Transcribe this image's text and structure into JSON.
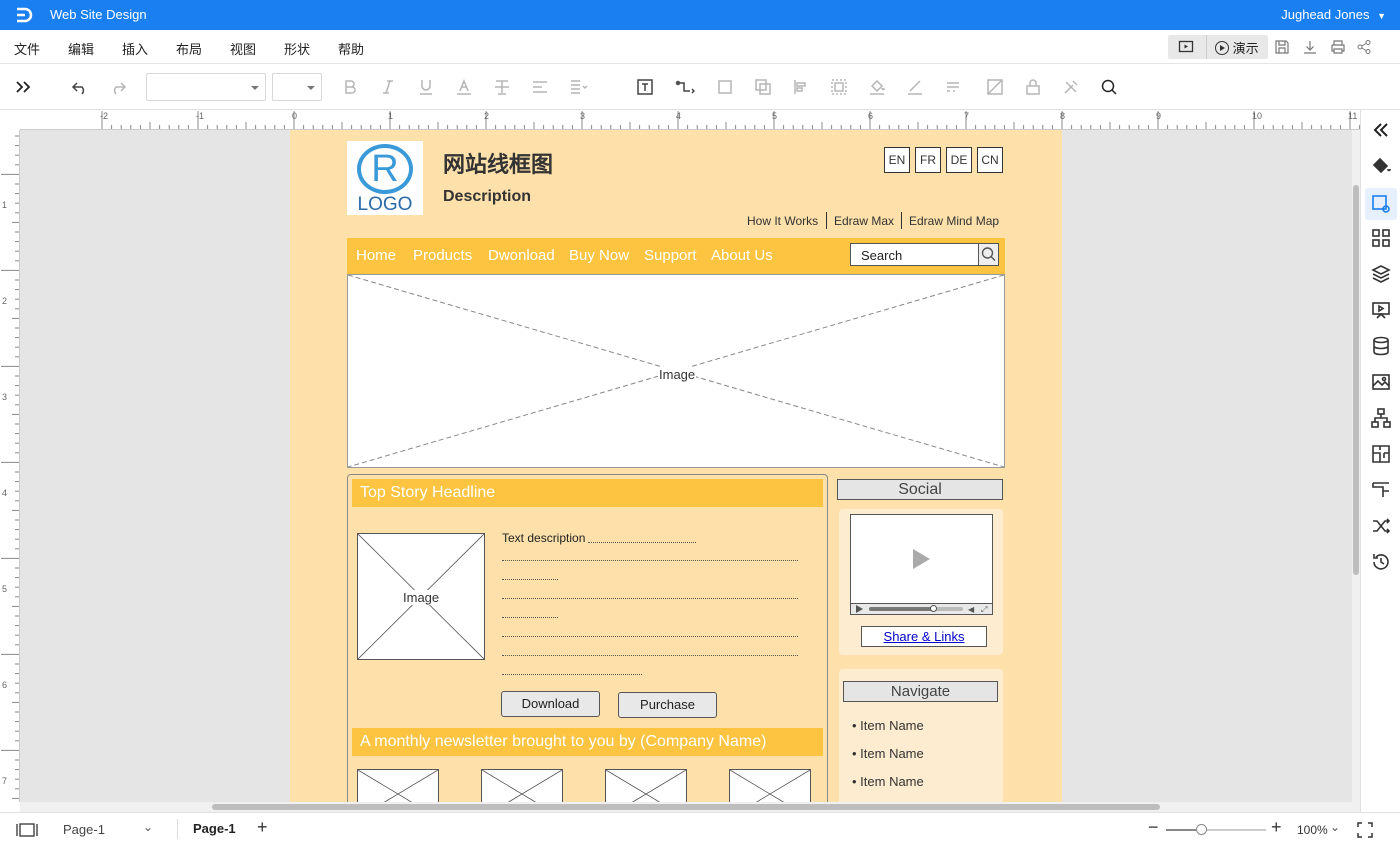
{
  "app": {
    "title": "Web Site Design",
    "user": "Jughead Jones"
  },
  "menu": [
    "文件",
    "编辑",
    "插入",
    "布局",
    "视图",
    "形状",
    "帮助"
  ],
  "present_label": "演示",
  "ruler_h": [
    "-2",
    "-1",
    "0",
    "1",
    "2",
    "3",
    "4",
    "5",
    "6",
    "7",
    "8",
    "9",
    "10",
    "11"
  ],
  "ruler_v": [
    "1",
    "2",
    "3",
    "4",
    "5",
    "6",
    "7"
  ],
  "wireframe": {
    "logo_mark": "R",
    "logo_text": "LOGO",
    "title": "网站线框图",
    "description": "Description",
    "languages": [
      "EN",
      "FR",
      "DE",
      "CN"
    ],
    "top_links": [
      "How It Works",
      "Edraw Max",
      "Edraw Mind Map"
    ],
    "nav": [
      "Home",
      "Products",
      "Dwonload",
      "Buy Now",
      "Support",
      "About Us"
    ],
    "search_value": "Search",
    "hero_label": "Image",
    "story_headline": "Top Story Headline",
    "story_image_label": "Image",
    "text_description": "Text description",
    "download_button": "Download",
    "purchase_button": "Purchase",
    "newsletter": "A monthly newsletter brought to you by (Company Name)",
    "social_title": "Social",
    "share_links": "Share & Links",
    "navigate_title": "Navigate",
    "nav_items": [
      "Item Name",
      "Item Name",
      "Item Name"
    ]
  },
  "status": {
    "page_selector": "Page-1",
    "active_page": "Page-1",
    "zoom": "100%",
    "zoom_level": 0.35
  }
}
